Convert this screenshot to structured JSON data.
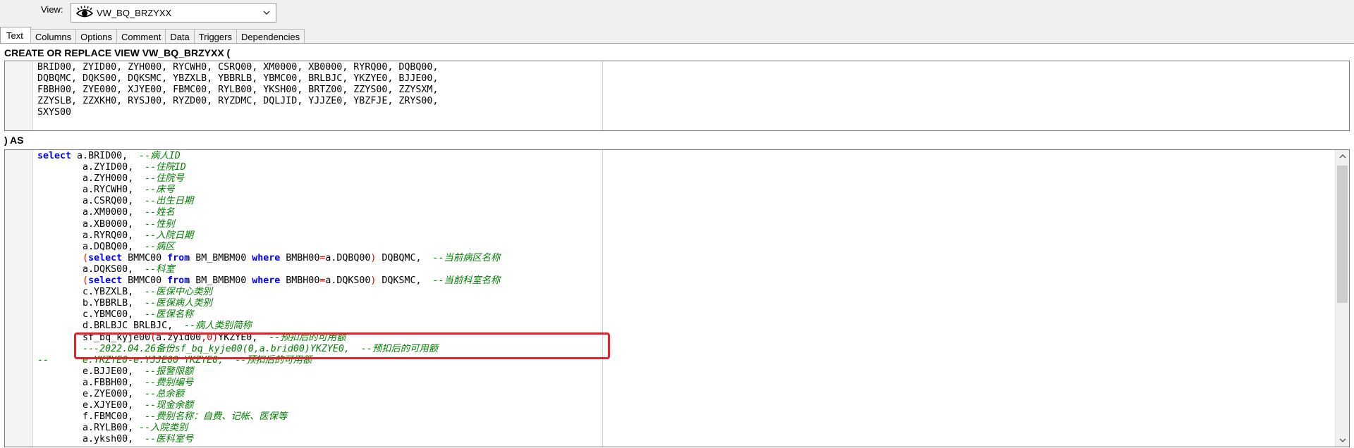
{
  "view": {
    "label": "View:",
    "selected": "VW_BQ_BRZYXX"
  },
  "tabs": [
    {
      "label": "Text",
      "active": true
    },
    {
      "label": "Columns"
    },
    {
      "label": "Options"
    },
    {
      "label": "Comment"
    },
    {
      "label": "Data"
    },
    {
      "label": "Triggers"
    },
    {
      "label": "Dependencies"
    }
  ],
  "header_create": "CREATE OR REPLACE VIEW VW_BQ_BRZYXX (",
  "header_as": ") AS",
  "columns_lines": [
    "BRID00, ZYID00, ZYH000, RYCWH0, CSRQ00, XM0000, XB0000, RYRQ00, DQBQ00,",
    "DQBQMC, DQKS00, DQKSMC, YBZXLB, YBBRLB, YBMC00, BRLBJC, YKZYE0, BJJE00,",
    "FBBH00, ZYE000, XJYE00, FBMC00, RYLB00, YKSH00, BRTZ00, ZZYS00, ZZYSXM,",
    "ZZYSLB, ZZXKH0, RYSJ00, RYZD00, RYZDMC, DQLJID, YJJZE0, YBZFJE, ZRYS00,",
    "SXYS00"
  ],
  "sql": {
    "l1_kw": "select",
    "l1_code": " a.BRID00,  ",
    "l1_cm": "--病人ID",
    "l2_code": "        a.ZYID00,  ",
    "l2_cm": "--住院ID",
    "l3_code": "        a.ZYH000,  ",
    "l3_cm": "--住院号",
    "l4_code": "        a.RYCWH0,  ",
    "l4_cm": "--床号",
    "l5_code": "        a.CSRQ00,  ",
    "l5_cm": "--出生日期",
    "l6_code": "        a.XM0000,  ",
    "l6_cm": "--姓名",
    "l7_code": "        a.XB0000,  ",
    "l7_cm": "--性别",
    "l8_code": "        a.RYRQ00,  ",
    "l8_cm": "--入院日期",
    "l9_code": "        a.DQBQ00,  ",
    "l9_cm": "--病区",
    "l10_pre": "        ",
    "l10_p1": "(",
    "l10_kw1": "select",
    "l10_c1": " BMMC00 ",
    "l10_kw2": "from",
    "l10_c2": " BM_BMBM00 ",
    "l10_kw3": "where",
    "l10_c3": " BMBH00",
    "l10_eq": "=",
    "l10_c4": "a.DQBQ00",
    "l10_p2": ")",
    "l10_c5": " DQBQMC,  ",
    "l10_cm": "--当前病区名称",
    "l11_code": "        a.DQKS00,  ",
    "l11_cm": "--科室",
    "l12_pre": "        ",
    "l12_p1": "(",
    "l12_kw1": "select",
    "l12_c1": " BMMC00 ",
    "l12_kw2": "from",
    "l12_c2": " BM_BMBM00 ",
    "l12_kw3": "where",
    "l12_c3": " BMBH00",
    "l12_eq": "=",
    "l12_c4": "a.DQKS00",
    "l12_p2": ")",
    "l12_c5": " DQKSMC,  ",
    "l12_cm": "--当前科室名称",
    "l13_code": "        c.YBZXLB,  ",
    "l13_cm": "--医保中心类别",
    "l14_code": "        b.YBBRLB,  ",
    "l14_cm": "--医保病人类别",
    "l15_code": "        c.YBMC00,  ",
    "l15_cm": "--医保名称",
    "l16_code": "        d.BRLBJC BRLBJC,  ",
    "l16_cm": "--病人类别简称",
    "l17_pre": "        sf_bq_kyje00",
    "l17_p1": "(",
    "l17_a": "a.zyid00",
    "l17_comma": ",",
    "l17_zero": "0",
    "l17_p2": ")",
    "l17_c": "YKZYE0,  ",
    "l17_cm": "--预扣后的可用额",
    "l18_pre": "        ",
    "l18_cm": "---2022.04.26备份sf_bq_kyje00(0,a.brid00)YKZYE0,  --预扣后的可用额",
    "l19_cm": "--      e.YKZYE0-e.YJJE00 YKZYE0,  --预扣后的可用额",
    "l20_code": "        e.BJJE00,  ",
    "l20_cm": "--报警限额",
    "l21_code": "        a.FBBH00,  ",
    "l21_cm": "--费别编号",
    "l22_code": "        e.ZYE000,  ",
    "l22_cm": "--总余额",
    "l23_code": "        e.XJYE00,  ",
    "l23_cm": "--现金余额",
    "l24_code": "        f.FBMC00,  ",
    "l24_cm": "--费别名称：自费、记帐、医保等",
    "l25_code": "        a.RYLB00, ",
    "l25_cm": "--入院类别",
    "l26_code": "        a.yksh00,  ",
    "l26_cm": "--医科室号"
  }
}
